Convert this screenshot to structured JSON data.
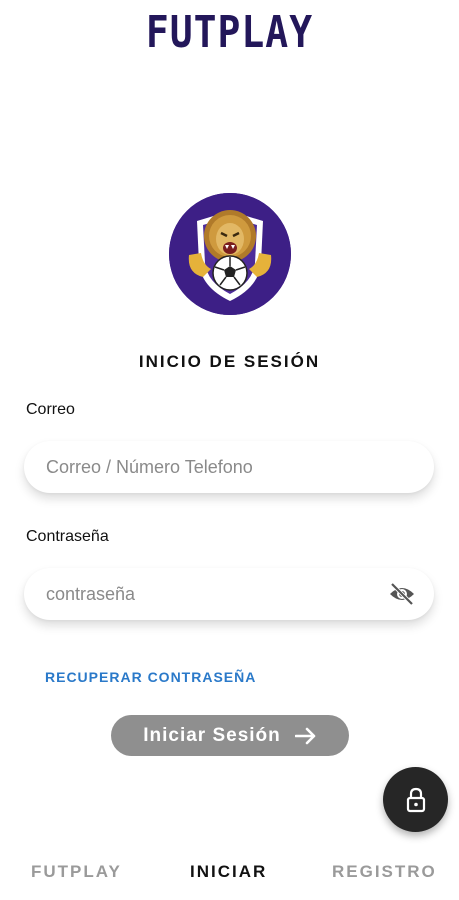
{
  "app": {
    "brand": "FUTPLAY"
  },
  "login": {
    "title": "INICIO DE SESIÓN",
    "email_label": "Correo",
    "email_placeholder": "Correo / Número Telefono",
    "password_label": "Contraseña",
    "password_placeholder": "contraseña",
    "recover_label": "RECUPERAR CONTRASEÑA",
    "submit_label": "Iniciar Sesión"
  },
  "fab": {
    "icon": "lock-icon"
  },
  "nav": {
    "items": [
      {
        "label": "FUTPLAY",
        "active": false
      },
      {
        "label": "INICIAR",
        "active": true
      },
      {
        "label": "REGISTRO",
        "active": false
      }
    ]
  },
  "colors": {
    "brand": "#23175a",
    "logo_background": "#3d1f86",
    "link": "#2a79c9",
    "button_disabled": "#8f8f8f",
    "fab": "#262626"
  }
}
